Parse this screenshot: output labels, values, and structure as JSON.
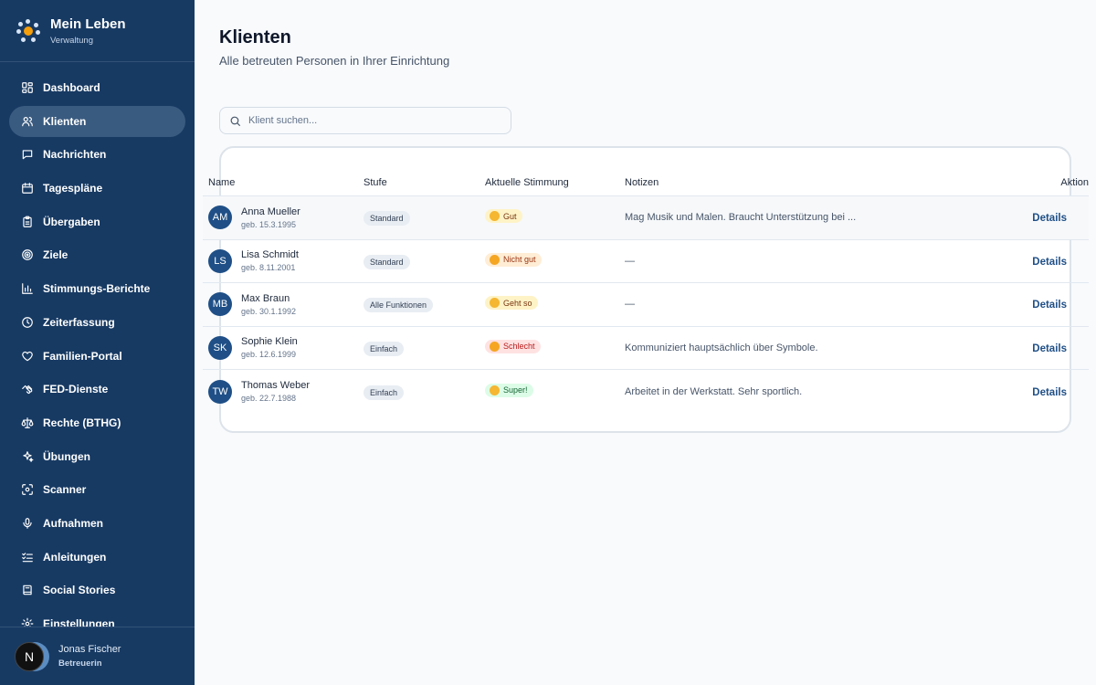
{
  "brand": {
    "title": "Mein Leben",
    "subtitle": "Verwaltung"
  },
  "nav": [
    {
      "label": "Dashboard",
      "icon": "dashboard-icon"
    },
    {
      "label": "Klienten",
      "icon": "users-icon",
      "active": true
    },
    {
      "label": "Nachrichten",
      "icon": "message-icon"
    },
    {
      "label": "Tagespläne",
      "icon": "calendar-icon"
    },
    {
      "label": "Übergaben",
      "icon": "clipboard-icon"
    },
    {
      "label": "Ziele",
      "icon": "target-icon"
    },
    {
      "label": "Stimmungs-Berichte",
      "icon": "bar-chart-icon"
    },
    {
      "label": "Zeiterfassung",
      "icon": "clock-icon"
    },
    {
      "label": "Familien-Portal",
      "icon": "heart-icon"
    },
    {
      "label": "FED-Dienste",
      "icon": "handshake-icon"
    },
    {
      "label": "Rechte (BTHG)",
      "icon": "scale-icon"
    },
    {
      "label": "Übungen",
      "icon": "sparkles-icon"
    },
    {
      "label": "Scanner",
      "icon": "scan-icon"
    },
    {
      "label": "Aufnahmen",
      "icon": "microphone-icon"
    },
    {
      "label": "Anleitungen",
      "icon": "list-checks-icon"
    },
    {
      "label": "Social Stories",
      "icon": "book-icon"
    },
    {
      "label": "Einstellungen",
      "icon": "settings-icon"
    }
  ],
  "user": {
    "initial": "N",
    "name": "Jonas Fischer",
    "role": "Betreuerin"
  },
  "page": {
    "title": "Klienten",
    "subtitle": "Alle betreuten Personen in Ihrer Einrichtung"
  },
  "search": {
    "placeholder": "Klient suchen...",
    "value": ""
  },
  "table": {
    "headers": {
      "name": "Name",
      "stufe": "Stufe",
      "mood": "Aktuelle Stimmung",
      "notes": "Notizen",
      "action": "Aktion"
    },
    "rows": [
      {
        "initials": "AM",
        "name": "Anna Mueller",
        "birth": "geb. 15.3.1995",
        "stufe": "Standard",
        "mood": "Gut",
        "mood_tone": "yellow",
        "notes": "Mag Musik und Malen. Braucht Unterstützung bei ...",
        "action": "Details"
      },
      {
        "initials": "LS",
        "name": "Lisa Schmidt",
        "birth": "geb. 8.11.2001",
        "stufe": "Standard",
        "mood": "Nicht gut",
        "mood_tone": "orange",
        "notes": "—",
        "action": "Details"
      },
      {
        "initials": "MB",
        "name": "Max Braun",
        "birth": "geb. 30.1.1992",
        "stufe": "Alle Funktionen",
        "mood": "Geht so",
        "mood_tone": "yellow",
        "notes": "—",
        "action": "Details"
      },
      {
        "initials": "SK",
        "name": "Sophie Klein",
        "birth": "geb. 12.6.1999",
        "stufe": "Einfach",
        "mood": "Schlecht",
        "mood_tone": "red",
        "notes": "Kommuniziert hauptsächlich über Symbole.",
        "action": "Details"
      },
      {
        "initials": "TW",
        "name": "Thomas Weber",
        "birth": "geb. 22.7.1988",
        "stufe": "Einfach",
        "mood": "Super!",
        "mood_tone": "green",
        "notes": "Arbeitet in der Werkstatt. Sehr sportlich.",
        "action": "Details"
      }
    ]
  },
  "colors": {
    "sidebar": "#173a63",
    "active_item": "#3a5b80",
    "accent": "#1f4f86",
    "logo_center": "#f59e0b"
  }
}
